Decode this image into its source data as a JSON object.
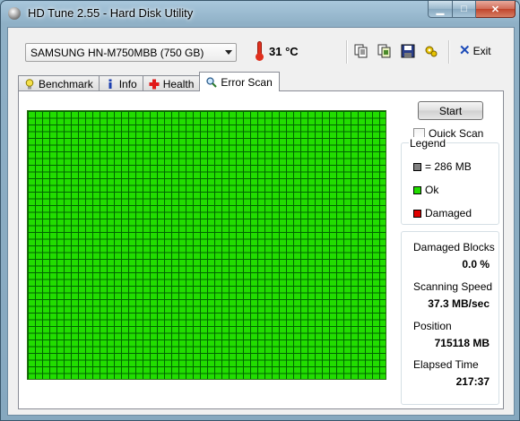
{
  "window": {
    "title": "HD Tune 2.55 - Hard Disk Utility",
    "caption_buttons": {
      "minimize": "▁",
      "maximize": "□",
      "close": "✕"
    }
  },
  "toolbar": {
    "drive": "SAMSUNG HN-M750MBB (750 GB)",
    "temperature": "31 °C",
    "exit_label": "Exit",
    "icons": [
      "copy-text-icon",
      "copy-screenshot-icon",
      "save-icon",
      "options-icon",
      "exit-icon"
    ]
  },
  "tabs": [
    {
      "label": "Benchmark",
      "icon": "bulb-icon"
    },
    {
      "label": "Info",
      "icon": "info-icon"
    },
    {
      "label": "Health",
      "icon": "health-cross-icon"
    },
    {
      "label": "Error Scan",
      "icon": "magnifier-icon",
      "active": true
    }
  ],
  "scan": {
    "start_label": "Start",
    "quick_scan_label": "Quick Scan",
    "quick_scan_checked": false,
    "block_status": "ok"
  },
  "legend": {
    "title": "Legend",
    "items": [
      {
        "label": "= 286 MB",
        "color": "#808080"
      },
      {
        "label": "Ok",
        "color": "#22dd00"
      },
      {
        "label": "Damaged",
        "color": "#e00000"
      }
    ]
  },
  "stats": {
    "damaged_blocks_label": "Damaged Blocks",
    "damaged_blocks_value": "0.0 %",
    "scanning_speed_label": "Scanning Speed",
    "scanning_speed_value": "37.3 MB/sec",
    "position_label": "Position",
    "position_value": "715118 MB",
    "elapsed_label": "Elapsed Time",
    "elapsed_value": "217:37"
  }
}
